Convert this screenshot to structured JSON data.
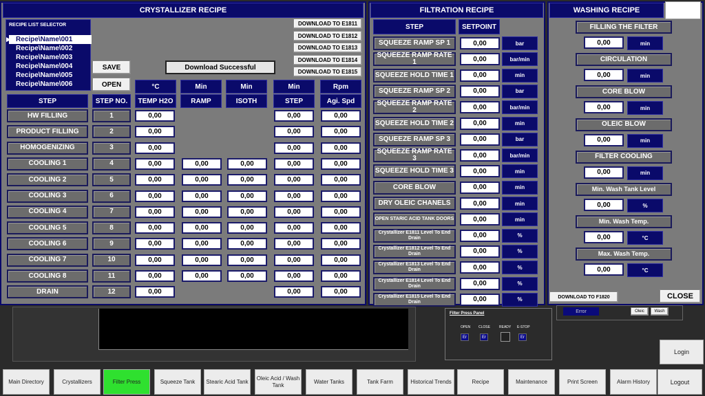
{
  "crystallizer": {
    "title": "CRYSTALLIZER RECIPE",
    "recipe_selector_title": "RECIPE LIST SELECTOR",
    "recipes": [
      "Recipe\\Name\\001",
      "Recipe\\Name\\002",
      "Recipe\\Name\\003",
      "Recipe\\Name\\004",
      "Recipe\\Name\\005",
      "Recipe\\Name\\006"
    ],
    "save": "SAVE",
    "open": "OPEN",
    "status": "Download Successful",
    "downloads": [
      "DOWNLOAD TO E1811",
      "DOWNLOAD TO E1812",
      "DOWNLOAD TO E1813",
      "DOWNLOAD TO E1814",
      "DOWNLOAD TO E1815"
    ],
    "units": [
      "°C",
      "Min",
      "Min",
      "Min",
      "Rpm"
    ],
    "headers": [
      "STEP",
      "STEP NO.",
      "TEMP H2O",
      "RAMP",
      "ISOTH",
      "STEP",
      "Agi. Spd"
    ],
    "rows": [
      {
        "step": "HW FILLING",
        "no": "1",
        "temp": "0,00",
        "ramp": "",
        "isoth": "",
        "stp": "0,00",
        "agi": "0,00"
      },
      {
        "step": "PRODUCT FILLING",
        "no": "2",
        "temp": "0,00",
        "ramp": "",
        "isoth": "",
        "stp": "0,00",
        "agi": "0,00"
      },
      {
        "step": "HOMOGENIZING",
        "no": "3",
        "temp": "0,00",
        "ramp": "",
        "isoth": "",
        "stp": "0,00",
        "agi": "0,00"
      },
      {
        "step": "COOLING 1",
        "no": "4",
        "temp": "0,00",
        "ramp": "0,00",
        "isoth": "0,00",
        "stp": "0,00",
        "agi": "0,00"
      },
      {
        "step": "COOLING 2",
        "no": "5",
        "temp": "0,00",
        "ramp": "0,00",
        "isoth": "0,00",
        "stp": "0,00",
        "agi": "0,00"
      },
      {
        "step": "COOLING 3",
        "no": "6",
        "temp": "0,00",
        "ramp": "0,00",
        "isoth": "0,00",
        "stp": "0,00",
        "agi": "0,00"
      },
      {
        "step": "COOLING 4",
        "no": "7",
        "temp": "0,00",
        "ramp": "0,00",
        "isoth": "0,00",
        "stp": "0,00",
        "agi": "0,00"
      },
      {
        "step": "COOLING 5",
        "no": "8",
        "temp": "0,00",
        "ramp": "0,00",
        "isoth": "0,00",
        "stp": "0,00",
        "agi": "0,00"
      },
      {
        "step": "COOLING 6",
        "no": "9",
        "temp": "0,00",
        "ramp": "0,00",
        "isoth": "0,00",
        "stp": "0,00",
        "agi": "0,00"
      },
      {
        "step": "COOLING 7",
        "no": "10",
        "temp": "0,00",
        "ramp": "0,00",
        "isoth": "0,00",
        "stp": "0,00",
        "agi": "0,00"
      },
      {
        "step": "COOLING 8",
        "no": "11",
        "temp": "0,00",
        "ramp": "0,00",
        "isoth": "0,00",
        "stp": "0,00",
        "agi": "0,00"
      },
      {
        "step": "DRAIN",
        "no": "12",
        "temp": "0,00",
        "ramp": "",
        "isoth": "",
        "stp": "0,00",
        "agi": "0,00"
      }
    ]
  },
  "filtration": {
    "title": "FILTRATION RECIPE",
    "headers": [
      "STEP",
      "SETPOINT"
    ],
    "rows": [
      {
        "label": "SQUEEZE RAMP SP 1",
        "value": "0,00",
        "unit": "bar",
        "small": false
      },
      {
        "label": "SQUEEZE RAMP RATE 1",
        "value": "0,00",
        "unit": "bar/min",
        "small": false
      },
      {
        "label": "SQUEEZE HOLD TIME 1",
        "value": "0,00",
        "unit": "min",
        "small": false
      },
      {
        "label": "SQUEEZE RAMP SP 2",
        "value": "0,00",
        "unit": "bar",
        "small": false
      },
      {
        "label": "SQUEEZE RAMP RATE 2",
        "value": "0,00",
        "unit": "bar/min",
        "small": false
      },
      {
        "label": "SQUEEZE HOLD TIME 2",
        "value": "0,00",
        "unit": "min",
        "small": false
      },
      {
        "label": "SQUEEZE RAMP SP 3",
        "value": "0,00",
        "unit": "bar",
        "small": false
      },
      {
        "label": "SQUEEZE RAMP RATE 3",
        "value": "0,00",
        "unit": "bar/min",
        "small": false
      },
      {
        "label": "SQUEEZE HOLD TIME 3",
        "value": "0,00",
        "unit": "min",
        "small": false
      },
      {
        "label": "CORE BLOW",
        "value": "0,00",
        "unit": "min",
        "small": false
      },
      {
        "label": "DRY OLEIC CHANELS",
        "value": "0,00",
        "unit": "min",
        "small": false
      },
      {
        "label": "OPEN STARIC ACID TANK DOORS",
        "value": "0,00",
        "unit": "min",
        "small": true
      },
      {
        "label": "Crystallizer E1811 Level To End Drain",
        "value": "0,00",
        "unit": "%",
        "small": true
      },
      {
        "label": "Crystallizer E1812 Level To End Drain",
        "value": "0,00",
        "unit": "%",
        "small": true
      },
      {
        "label": "Crystallizer E1813 Level To End Drain",
        "value": "0,00",
        "unit": "%",
        "small": true
      },
      {
        "label": "Crystallizer E1814 Level To End Drain",
        "value": "0,00",
        "unit": "%",
        "small": true
      },
      {
        "label": "Crystallizer E1815 Level To End Drain",
        "value": "0,00",
        "unit": "%",
        "small": true
      }
    ]
  },
  "washing": {
    "title": "WASHING RECIPE",
    "items": [
      {
        "label": "FILLING THE FILTER",
        "value": "0,00",
        "unit": "min"
      },
      {
        "label": "CIRCULATION",
        "value": "0,00",
        "unit": "min"
      },
      {
        "label": "CORE BLOW",
        "value": "0,00",
        "unit": "min"
      },
      {
        "label": "OLEIC BLOW",
        "value": "0,00",
        "unit": "min"
      },
      {
        "label": "FILTER COOLING",
        "value": "0,00",
        "unit": "min"
      },
      {
        "label": "Min. Wash Tank Level",
        "value": "0,00",
        "unit": "%"
      },
      {
        "label": "Min. Wash Temp.",
        "value": "0,00",
        "unit": "°C"
      },
      {
        "label": "Max. Wash Temp.",
        "value": "0,00",
        "unit": "°C"
      }
    ],
    "download": "DOWNLOAD TO F1820",
    "close": "CLOSE"
  },
  "background": {
    "panel_title": "Filter Press Panel",
    "open": "OPEN",
    "close": "CLOSE",
    "ready": "READY",
    "estop": "E-STOP",
    "err": "Er",
    "error": "Error",
    "oleic": "Oleic",
    "wash": "Wash",
    "login": "Login",
    "logout": "Logout"
  },
  "nav": [
    {
      "label": "Main Directory",
      "active": false
    },
    {
      "label": "Crystallizers",
      "active": false
    },
    {
      "label": "Filter Press",
      "active": true
    },
    {
      "label": "Squeeze Tank",
      "active": false
    },
    {
      "label": "Stearic Acid Tank",
      "active": false
    },
    {
      "label": "Oleic Acid / Wash Tank",
      "active": false
    },
    {
      "label": "Water Tanks",
      "active": false
    },
    {
      "label": "Tank Farm",
      "active": false
    },
    {
      "label": "Historical Trends",
      "active": false
    },
    {
      "label": "Recipe",
      "active": false
    },
    {
      "label": "Maintenance",
      "active": false
    },
    {
      "label": "Print Screen",
      "active": false
    },
    {
      "label": "Alarm History",
      "active": false
    }
  ]
}
